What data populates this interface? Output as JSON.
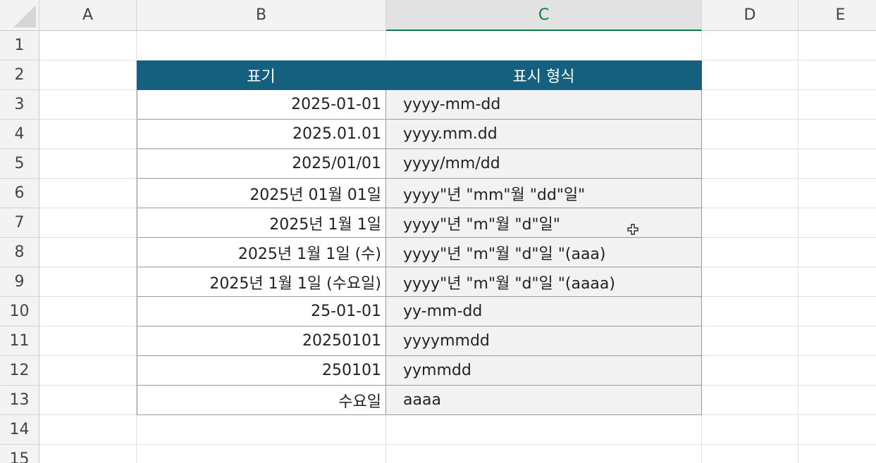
{
  "columns": [
    "A",
    "B",
    "C",
    "D",
    "E"
  ],
  "selected_column": "C",
  "rows": [
    "1",
    "2",
    "3",
    "4",
    "5",
    "6",
    "7",
    "8",
    "9",
    "10",
    "11",
    "12",
    "13",
    "14",
    "15"
  ],
  "table": {
    "header": {
      "notation": "표기",
      "format": "표시 형식"
    },
    "entries": [
      {
        "notation": "2025-01-01",
        "format": "yyyy-mm-dd"
      },
      {
        "notation": "2025.01.01",
        "format": "yyyy.mm.dd"
      },
      {
        "notation": "2025/01/01",
        "format": "yyyy/mm/dd"
      },
      {
        "notation": "2025년 01월 01일",
        "format": "yyyy\"년 \"mm\"월 \"dd\"일\""
      },
      {
        "notation": "2025년 1월 1일",
        "format": "yyyy\"년 \"m\"월 \"d\"일\""
      },
      {
        "notation": "2025년 1월 1일 (수)",
        "format": "yyyy\"년 \"m\"월 \"d\"일 \"(aaa)"
      },
      {
        "notation": "2025년 1월 1일 (수요일)",
        "format": "yyyy\"년 \"m\"월 \"d\"일 \"(aaaa)"
      },
      {
        "notation": "25-01-01",
        "format": "yy-mm-dd"
      },
      {
        "notation": "20250101",
        "format": "yyyymmdd"
      },
      {
        "notation": "250101",
        "format": "yymmdd"
      },
      {
        "notation": "수요일",
        "format": "aaaa"
      }
    ]
  },
  "colors": {
    "header_fill": "#16607f",
    "format_fill": "#f2f2f2",
    "selected_header_text": "#107c41"
  },
  "cursor": {
    "icon": "cell-select-cursor-icon"
  }
}
